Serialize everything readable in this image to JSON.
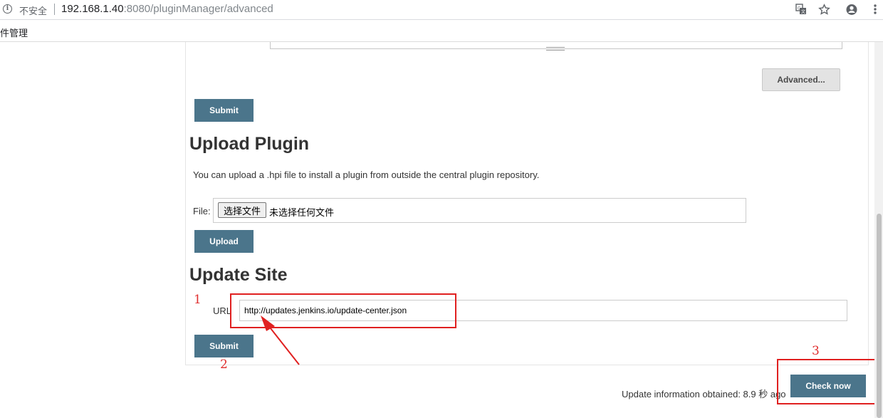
{
  "browser": {
    "security_label": "不安全",
    "url_host": "192.168.1.40",
    "url_rest": ":8080/pluginManager/advanced",
    "bookmark_item": "件管理"
  },
  "proxy_section": {
    "advanced_label": "Advanced...",
    "submit_label": "Submit"
  },
  "upload_section": {
    "title": "Upload Plugin",
    "description": "You can upload a .hpi file to install a plugin from outside the central plugin repository.",
    "file_label": "File:",
    "choose_file_label": "选择文件",
    "no_file_label": "未选择任何文件",
    "upload_label": "Upload"
  },
  "update_site_section": {
    "title": "Update Site",
    "url_label": "URL",
    "url_value": "http://updates.jenkins.io/update-center.json",
    "submit_label": "Submit"
  },
  "footer": {
    "update_info": "Update information obtained: 8.9 秒 ago",
    "check_now_label": "Check now"
  },
  "annotations": {
    "n1": "1",
    "n2": "2",
    "n3": "3",
    "color": "#e02020"
  },
  "theme": {
    "button_blue": "#4b758b",
    "button_grey": "#e3e3e3"
  }
}
